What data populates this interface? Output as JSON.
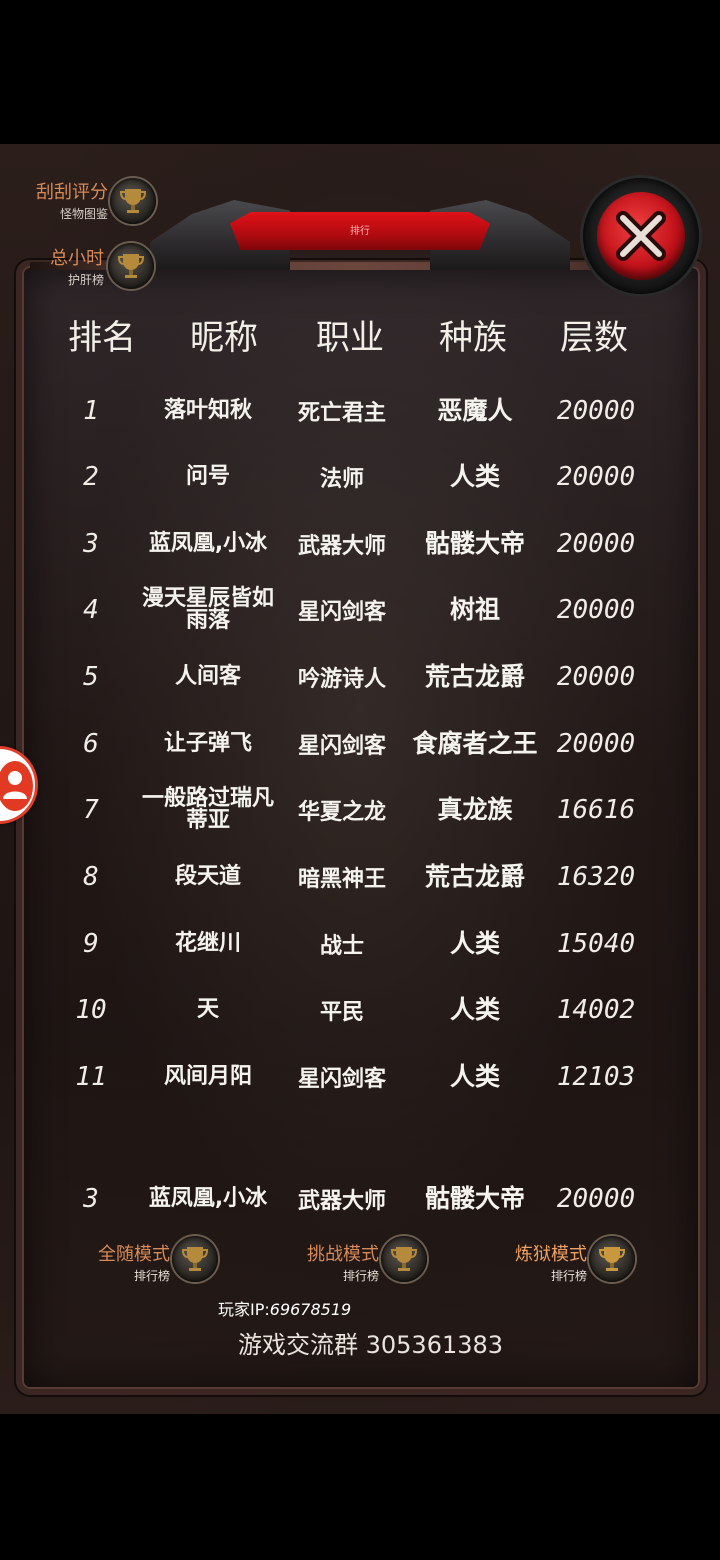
{
  "header": {
    "ribbon_text": "排行",
    "columns": [
      "排名",
      "昵称",
      "职业",
      "种族",
      "层数"
    ]
  },
  "side_buttons": [
    {
      "main": "刮刮评分",
      "sub": "怪物图鉴"
    },
    {
      "main": "总小时",
      "sub": "护肝榜"
    }
  ],
  "rows": [
    {
      "rank": "1",
      "name": "落叶知秋",
      "job": "死亡君主",
      "race": "恶魔人",
      "level": "20000"
    },
    {
      "rank": "2",
      "name": "问号",
      "job": "法师",
      "race": "人类",
      "level": "20000"
    },
    {
      "rank": "3",
      "name": "蓝凤凰,小冰",
      "job": "武器大师",
      "race": "骷髅大帝",
      "level": "20000"
    },
    {
      "rank": "4",
      "name": "漫天星辰皆如雨落",
      "job": "星闪剑客",
      "race": "树祖",
      "level": "20000"
    },
    {
      "rank": "5",
      "name": "人间客",
      "job": "吟游诗人",
      "race": "荒古龙爵",
      "level": "20000"
    },
    {
      "rank": "6",
      "name": "让子弹飞",
      "job": "星闪剑客",
      "race": "食腐者之王",
      "level": "20000"
    },
    {
      "rank": "7",
      "name": "一般路过瑞凡蒂亚",
      "job": "华夏之龙",
      "race": "真龙族",
      "level": "16616"
    },
    {
      "rank": "8",
      "name": "段天道",
      "job": "暗黑神王",
      "race": "荒古龙爵",
      "level": "16320"
    },
    {
      "rank": "9",
      "name": "花继川",
      "job": "战士",
      "race": "人类",
      "level": "15040"
    },
    {
      "rank": "10",
      "name": "天",
      "job": "平民",
      "race": "人类",
      "level": "14002"
    },
    {
      "rank": "11",
      "name": "风间月阳",
      "job": "星闪剑客",
      "race": "人类",
      "level": "12103"
    }
  ],
  "my_row": {
    "rank": "3",
    "name": "蓝凤凰,小冰",
    "job": "武器大师",
    "race": "骷髅大帝",
    "level": "20000"
  },
  "modes": [
    {
      "main": "全随模式",
      "sub": "排行榜"
    },
    {
      "main": "挑战模式",
      "sub": "排行榜"
    },
    {
      "main": "炼狱模式",
      "sub": "排行榜"
    }
  ],
  "footer": {
    "ip_label": "玩家IP:",
    "ip_value": "69678519",
    "group": "游戏交流群 305361383"
  },
  "colors": {
    "accent_red": "#c3121a",
    "label_orange": "#d88a58"
  }
}
